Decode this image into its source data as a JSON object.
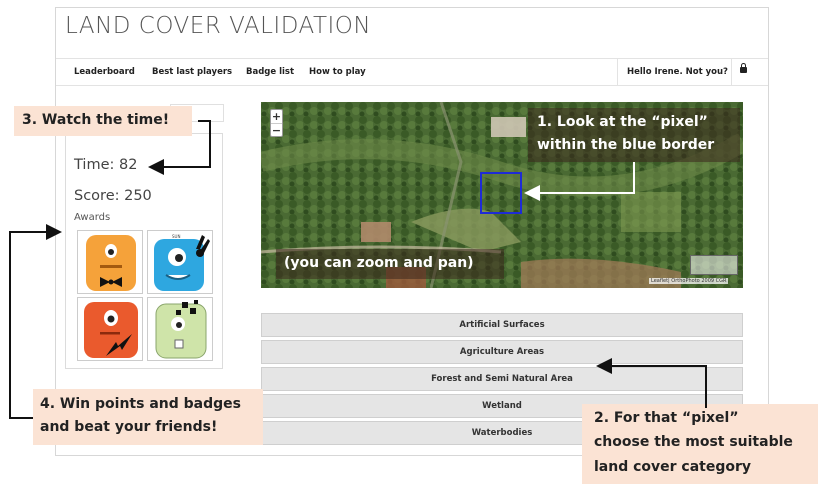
{
  "app": {
    "title": "LAND COVER VALIDATION"
  },
  "nav": {
    "items": [
      {
        "label": "Leaderboard"
      },
      {
        "label": "Best last players"
      },
      {
        "label": "Badge list"
      },
      {
        "label": "How to play"
      }
    ],
    "greeting": "Hello Irene. Not you?"
  },
  "stats": {
    "time": "Time: 82",
    "score": "Score: 250",
    "awards_label": "Awards"
  },
  "badges": [
    {
      "name": "orange-monster-badge",
      "color": "#f5a23a"
    },
    {
      "name": "blue-monster-badge",
      "color": "#2ea7e0"
    },
    {
      "name": "red-monster-badge",
      "color": "#ea5a2d"
    },
    {
      "name": "green-monster-badge",
      "color": "#cfe4a9"
    }
  ],
  "categories": [
    "Artificial Surfaces",
    "Agriculture Areas",
    "Forest and Semi Natural Area",
    "Wetland",
    "Waterbodies"
  ],
  "map": {
    "zoom_in": "+",
    "zoom_out": "−",
    "attribution": "Leaflet| OrthoPhoto 2009 CGR"
  },
  "callouts": {
    "watch_time": "3. Watch the time!",
    "pixel_line1": "1. Look at the “pixel”",
    "pixel_line2": "within the blue border",
    "zoom_pan": "(you can zoom and pan)",
    "win_line1": "4. Win points and badges",
    "win_line2": "and beat your friends!",
    "choose_line1": "2. For that “pixel”",
    "choose_line2": "choose the most suitable",
    "choose_line3": "land cover category"
  },
  "colors": {
    "callout_bg": "#fbe3d4",
    "pixel_border": "#1e2bd6",
    "button_bg": "#e5e5e5"
  }
}
